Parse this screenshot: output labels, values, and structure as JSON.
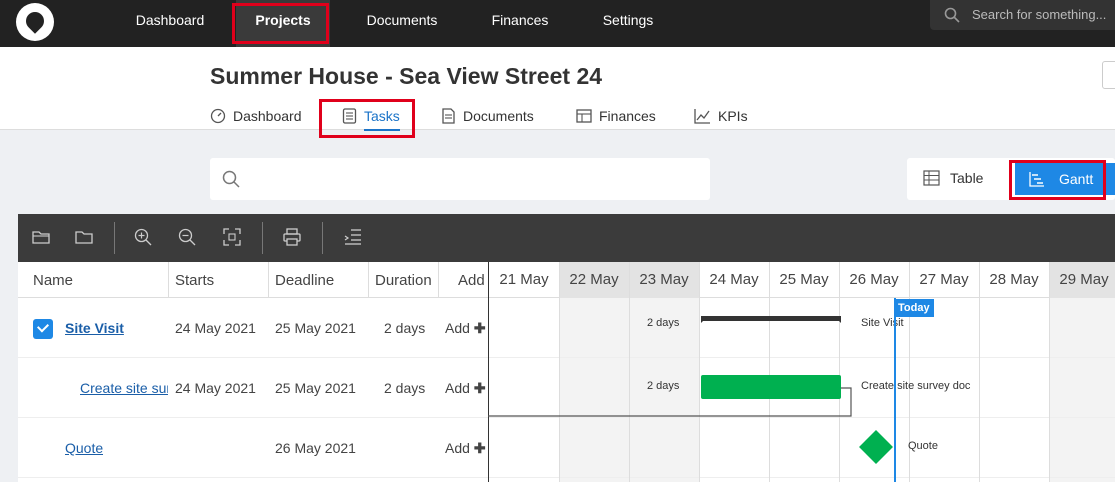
{
  "topnav": {
    "items": [
      {
        "label": "Dashboard"
      },
      {
        "label": "Projects",
        "active": true
      },
      {
        "label": "Documents"
      },
      {
        "label": "Finances"
      },
      {
        "label": "Settings"
      }
    ],
    "search_placeholder": "Search for something..."
  },
  "project": {
    "title": "Summer House - Sea View Street 24",
    "tabs": [
      {
        "label": "Dashboard",
        "icon": "dashboard-gauge-icon"
      },
      {
        "label": "Tasks",
        "icon": "tasks-list-icon",
        "active": true
      },
      {
        "label": "Documents",
        "icon": "documents-icon"
      },
      {
        "label": "Finances",
        "icon": "finances-icon"
      },
      {
        "label": "KPIs",
        "icon": "kpi-chart-icon"
      }
    ]
  },
  "task_search": {
    "placeholder": ""
  },
  "view_toggle": {
    "table_label": "Table",
    "gantt_label": "Gantt",
    "active": "Gantt"
  },
  "toolbar": {
    "icons": [
      "open-folder-icon",
      "folder-icon",
      "zoom-in-icon",
      "zoom-out-icon",
      "fit-screen-icon",
      "print-icon",
      "indent-icon"
    ]
  },
  "grid": {
    "columns": [
      "Name",
      "Starts",
      "Deadline",
      "Duration",
      "Add"
    ],
    "days": [
      "21 May",
      "22 May",
      "23 May",
      "24 May",
      "25 May",
      "26 May",
      "27 May",
      "28 May",
      "29 May"
    ],
    "weekend_days": [
      "22 May",
      "23 May",
      "29 May"
    ],
    "today_label": "Today",
    "rows": [
      {
        "name": "Site Visit",
        "starts": "24 May 2021",
        "deadline": "25 May 2021",
        "duration": "2 days",
        "add": "Add",
        "gantt_left_label": "2 days",
        "gantt_right_label": "Site Visit",
        "type": "summary"
      },
      {
        "name": "Create site survey doc",
        "starts": "24 May 2021",
        "deadline": "25 May 2021",
        "duration": "2 days",
        "add": "Add",
        "gantt_left_label": "2 days",
        "gantt_right_label": "Create site survey doc",
        "type": "task"
      },
      {
        "name": "Quote",
        "starts": "",
        "deadline": "26 May 2021",
        "duration": "",
        "add": "Add",
        "gantt_left_label": "",
        "gantt_right_label": "Quote",
        "type": "milestone"
      }
    ]
  },
  "colors": {
    "nav_bg": "#222222",
    "accent": "#1e88e5",
    "task_bar": "#00b050",
    "highlight": "#e0001b"
  }
}
